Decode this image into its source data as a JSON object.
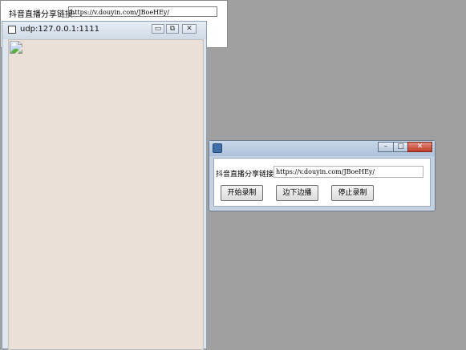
{
  "background_window": {
    "label": "抖音直播分享链接:",
    "url_value": "https://v.douyin.com/JBoeHEy/"
  },
  "player_window": {
    "title": "udp:127.0.0.1:1111",
    "controls": {
      "minimize": "▭",
      "restore": "⧉",
      "close": "✕"
    }
  },
  "dialog": {
    "controls": {
      "minimize": "–",
      "maximize": "□",
      "close": "✕"
    },
    "label": "抖音直播分享链接:",
    "url_value": "https://v.douyin.com/JBoeHEy/",
    "buttons": {
      "start": "开始录制",
      "record_while_playing": "边下边播",
      "stop": "停止录制"
    }
  },
  "icons": {
    "player_app": "app-icon",
    "dialog_app": "app-icon"
  },
  "colors": {
    "desktop": "#a0a0a0",
    "close_button": "#c13a28"
  }
}
